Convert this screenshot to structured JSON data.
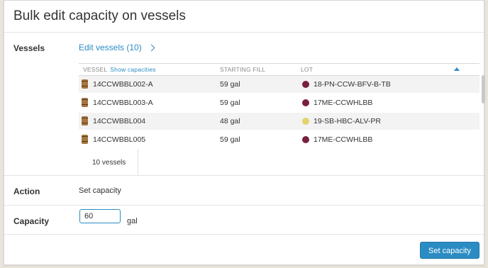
{
  "title": "Bulk edit capacity on vessels",
  "vessels_label": "Vessels",
  "edit_vessels_link": "Edit vessels (10)",
  "table": {
    "columns": {
      "vessel": "VESSEL",
      "show_capacities": "Show capacities",
      "starting_fill": "STARTING FILL",
      "lot": "LOT"
    },
    "rows": [
      {
        "vessel": "14CCWBBL002-A",
        "fill": "59 gal",
        "lot": "18-PN-CCW-BFV-B-TB",
        "lot_color": "#7a1f3d",
        "alt": true
      },
      {
        "vessel": "14CCWBBL003-A",
        "fill": "59 gal",
        "lot": "17ME-CCWHLBB",
        "lot_color": "#7a1f3d",
        "alt": false
      },
      {
        "vessel": "14CCWBBL004",
        "fill": "48 gal",
        "lot": "19-SB-HBC-ALV-PR",
        "lot_color": "#e3d36a",
        "alt": true
      },
      {
        "vessel": "14CCWBBL005",
        "fill": "59 gal",
        "lot": "17ME-CCWHLBB",
        "lot_color": "#7a1f3d",
        "alt": false
      }
    ],
    "count_label": "10 vessels"
  },
  "action_label": "Action",
  "action_value": "Set capacity",
  "capacity_label": "Capacity",
  "capacity_value": "60",
  "capacity_unit": "gal",
  "submit_label": "Set capacity"
}
